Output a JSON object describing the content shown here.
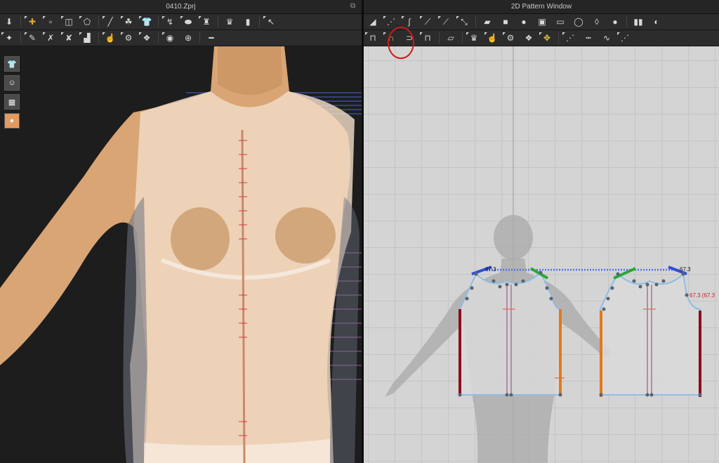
{
  "left_window": {
    "title": "0410.Zprj",
    "toolbar_row1_icons": [
      "select-move-icon",
      "transform-icon",
      "box-select-icon",
      "edit-box-icon",
      "gizmo-icon",
      "pin-icon",
      "tack-icon",
      "shirt-icon",
      "fold-arrow-icon",
      "measure-icon",
      "body-icon",
      "avatar-icon",
      "curve-icon"
    ],
    "toolbar_row2_icons": [
      "walk-icon",
      "simulate-icon",
      "pose-icon",
      "x-pose-icon",
      "garment-icon",
      "hand-icon",
      "sew-icon",
      "pattern-icon",
      "target-icon",
      "circle-icon",
      "line-icon"
    ],
    "side_icons": [
      "garment-view-icon",
      "avatar-view-icon",
      "texture-view-icon",
      "skin-view-icon"
    ]
  },
  "right_window": {
    "title": "2D Pattern Window",
    "toolbar_row1_icons": [
      "select-pattern-icon",
      "edit-point-icon",
      "curve-point-icon",
      "edit-curvature-icon",
      "segment-icon",
      "polygon-icon",
      "rectangle-icon",
      "circle-icon",
      "square-icon",
      "internal-polygon-icon",
      "internal-rect-icon",
      "internal-circle-icon",
      "dart-icon",
      "pleat-icon"
    ],
    "toolbar_row2_icons": [
      "segment-sewing-icon",
      "free-sewing-icon",
      "sewing-check-icon",
      "edit-sewing-icon",
      "tape-icon",
      "trim-icon",
      "fold-icon",
      "notch-icon",
      "button-icon",
      "dotted-line-icon",
      "topstitch-icon",
      "stitch-line-icon",
      "zigzag-icon",
      "line-icon"
    ]
  },
  "measurements": {
    "left_shoulder": "67.3",
    "right_shoulder": "67.3",
    "red_label": "67.3 (67.3"
  },
  "colors": {
    "highlight": "#d01818",
    "sewing_blue": "#2f4fd6",
    "sewing_green": "#2aa83c",
    "sewing_orange": "#e07a1a",
    "sewing_darkred": "#8a0f1c",
    "pattern_outline": "#8fbde6"
  }
}
